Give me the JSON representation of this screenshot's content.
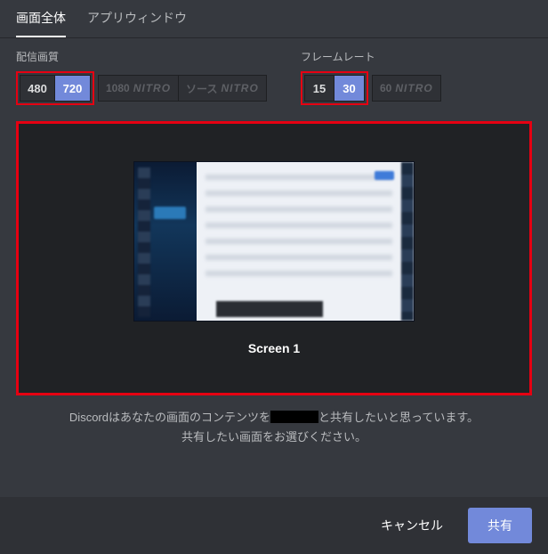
{
  "tabs": {
    "full_screen": "画面全体",
    "app_window": "アプリウィンドウ",
    "active": "full_screen"
  },
  "quality": {
    "label": "配信画質",
    "options": [
      "480",
      "720"
    ],
    "selected": "720",
    "nitro_1080": "1080",
    "nitro_source": "ソース",
    "nitro_word": "NITRO"
  },
  "framerate": {
    "label": "フレームレート",
    "options": [
      "15",
      "30"
    ],
    "selected": "30",
    "nitro_60": "60",
    "nitro_word": "NITRO"
  },
  "preview": {
    "screen_label": "Screen 1"
  },
  "description": {
    "line1_a": "Discordはあなたの画面のコンテンツを",
    "line1_b": "と共有したいと思っています。",
    "line2": "共有したい画面をお選びください。"
  },
  "footer": {
    "cancel": "キャンセル",
    "share": "共有"
  },
  "colors": {
    "highlight_border": "#e60012",
    "accent": "#7289da",
    "bg": "#36393f"
  }
}
